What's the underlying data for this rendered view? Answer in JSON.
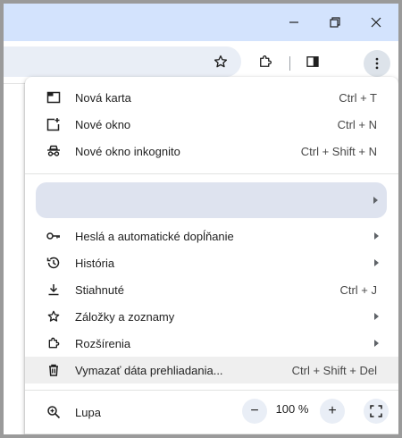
{
  "window": {
    "minimize_icon": "minimize-icon",
    "restore_icon": "restore-icon",
    "close_icon": "close-icon"
  },
  "toolbar": {
    "bookmark_icon": "star-icon",
    "extensions_icon": "puzzle-icon",
    "side_panel_icon": "side-panel-icon",
    "menu_icon": "three-dots-icon"
  },
  "menu": {
    "new_tab": {
      "label": "Nová karta",
      "shortcut": "Ctrl + T"
    },
    "new_window": {
      "label": "Nové okno",
      "shortcut": "Ctrl + N"
    },
    "incognito": {
      "label": "Nové okno inkognito",
      "shortcut": "Ctrl + Shift + N"
    },
    "passwords": {
      "label": "Heslá a automatické dopĺňanie"
    },
    "history": {
      "label": "História"
    },
    "downloads": {
      "label": "Stiahnuté",
      "shortcut": "Ctrl + J"
    },
    "bookmarks": {
      "label": "Záložky a zoznamy"
    },
    "extensions": {
      "label": "Rozšírenia"
    },
    "clear_data": {
      "label": "Vymazať dáta prehliadania...",
      "shortcut": "Ctrl + Shift + Del"
    },
    "zoom": {
      "label": "Lupa",
      "minus": "−",
      "value": "100 %",
      "plus": "+"
    }
  },
  "colors": {
    "titlebar": "#d3e3fd",
    "profile_pill": "#dee3ef",
    "hover": "#efefef"
  }
}
